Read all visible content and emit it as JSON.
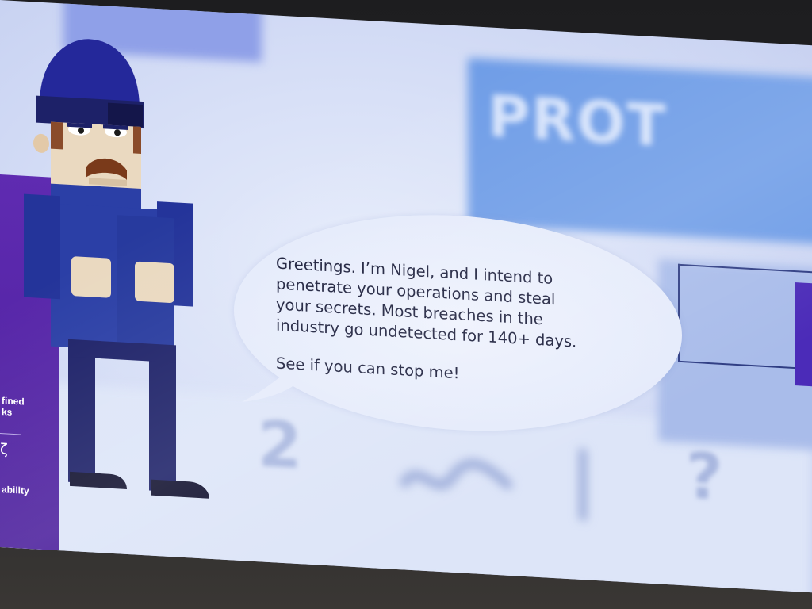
{
  "bubble": {
    "line1": "Greetings. I’m Nigel, and I intend to",
    "line2": "penetrate your operations and steal",
    "line3": "your secrets. Most breaches in the",
    "line4": "industry go undetected for 140+ days.",
    "line5": "See if you can stop me!"
  },
  "background": {
    "banner_text": "PROT",
    "glyph_1": "2",
    "glyph_2": "?"
  },
  "left_strip": {
    "text_top_line1": "fined",
    "text_top_line2": "ks",
    "text_bottom": "ability"
  },
  "colors": {
    "screen_bg": "#d8e0f7",
    "character_blue": "#2b3fa6",
    "character_dark": "#1d2168",
    "strip_purple": "#5f2bb1",
    "bubble_fill": "#e8edfc",
    "text": "#1a1d3a"
  }
}
